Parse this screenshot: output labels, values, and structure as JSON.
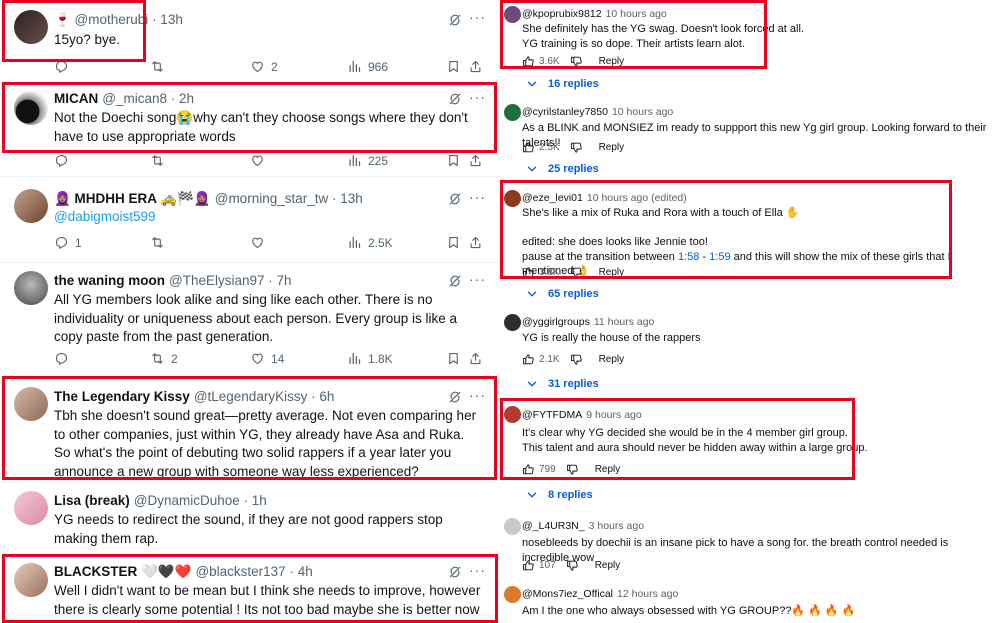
{
  "twitter": {
    "more_label": "···",
    "tweets": [
      {
        "name": "",
        "handle": "🍷 @motherubi",
        "time": "· 13h",
        "text": "15yo? bye.",
        "reply": "",
        "retweet": "",
        "like": "2",
        "views": "966"
      },
      {
        "name": "MICAN",
        "handle": "@_mican8",
        "time": "· 2h",
        "text": "Not the Doechi song😭why can't they choose songs where they don't have to use appropriate words",
        "reply": "",
        "retweet": "",
        "like": "",
        "views": "225"
      },
      {
        "name": "🧕🏽 MHDHH ERA 🚕🏁🧕🏽",
        "handle": "@morning_star_tw",
        "time": "· 13h",
        "text": "@dabigmoist599",
        "reply": "1",
        "retweet": "",
        "like": "",
        "views": "2.5K"
      },
      {
        "name": "the waning moon",
        "handle": "@TheElysian97",
        "time": "· 7h",
        "text": "All YG members look alike and sing like each other. There is no individuality or uniqueness about each person. Every group is like a copy paste from the past generation.",
        "reply": "",
        "retweet": "2",
        "like": "14",
        "views": "1.8K"
      },
      {
        "name": "The Legendary Kissy",
        "handle": "@tLegendaryKissy",
        "time": "· 6h",
        "text": "Tbh she doesn't sound great—pretty average. Not even comparing her to other companies, just within YG, they already have Asa and Ruka. So what's the point of debuting two solid rappers if a year later you announce a new group with someone way less experienced?",
        "reply": "",
        "retweet": "",
        "like": "",
        "views": ""
      },
      {
        "name": "Lisa (break)",
        "handle": "@DynamicDuhoe",
        "time": "· 1h",
        "text": "YG needs to redirect the sound, if they are not good rappers stop making them rap.",
        "reply": "",
        "retweet": "",
        "like": "",
        "views": ""
      },
      {
        "name": "BLACKSTER 🤍🖤❤️",
        "handle": "@blackster137",
        "time": "· 4h",
        "text": "Well I didn't want to be mean but I think she needs to improve, however there is clearly some potential ! Its not too bad maybe she is better now 😏",
        "reply": "",
        "retweet": "",
        "like": "",
        "views": ""
      }
    ]
  },
  "youtube": {
    "reply_label": "Reply",
    "comments": [
      {
        "user": "@kpoprubix9812",
        "time": "10 hours ago",
        "lines": [
          "She definitely has the YG swag. Doesn't look forced at all.",
          "YG training is so dope. Their artists learn alot."
        ],
        "likes": "3.6K",
        "replies": "16 replies"
      },
      {
        "user": "@cyrilstanley7850",
        "time": "10 hours ago",
        "lines": [
          "As a BLINK and MONSIEZ im ready to suppport this new Yg girl group. Looking forward to their talents!!"
        ],
        "likes": "2.5K",
        "replies": "25 replies"
      },
      {
        "user": "@eze_levi01",
        "time": "10 hours ago (edited)",
        "lines": [
          "She's like a mix of Ruka and Rora with a touch of Ella ✋",
          "",
          "edited: she does looks like Jennie too!"
        ],
        "line4_pre": "pause at the transition between ",
        "ts1": "1:58",
        "ts_sep": " - ",
        "ts2": "1:59",
        "line4_post": " and this will show the mix of these girls that I mentioned 👌",
        "likes": "3.8K",
        "replies": "65 replies"
      },
      {
        "user": "@yggirlgroups",
        "time": "11 hours ago",
        "lines": [
          "YG is really the house of the rappers"
        ],
        "likes": "2.1K",
        "replies": "31 replies"
      },
      {
        "user": "@FYTFDMA",
        "time": "9 hours ago",
        "lines": [
          "It's clear why YG decided she would be in the 4 member girl group.",
          "This talent and aura should never be hidden away within a large group."
        ],
        "likes": "799",
        "replies": "8 replies"
      },
      {
        "user": "@_L4UR3N_",
        "time": "3 hours ago",
        "lines": [
          "nosebleeds by doechii is an insane pick to have a song for. the breath control needed is incredible wow"
        ],
        "likes": "107",
        "replies": ""
      },
      {
        "user": "@Mons7iez_Offical",
        "time": "12 hours ago",
        "lines": [
          "Am I the one who always obsessed with YG GROUP??🔥 🔥 🔥 🔥"
        ],
        "likes": "",
        "replies": ""
      }
    ]
  },
  "colors": {
    "highlight": "#e8001c",
    "link": "#1d9bf0",
    "yt_link": "#065fd4"
  }
}
